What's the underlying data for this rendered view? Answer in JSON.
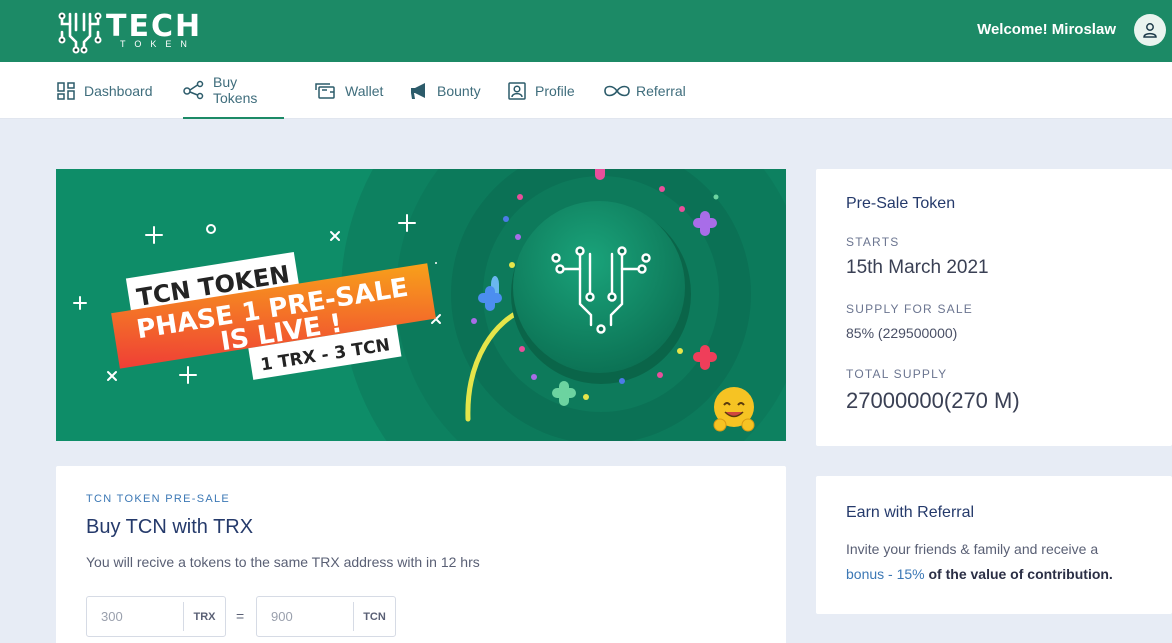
{
  "header": {
    "logo_word": "TECH",
    "logo_sub": "TOKEN",
    "welcome": "Welcome! Miroslaw"
  },
  "nav": {
    "items": [
      {
        "label": "Dashboard",
        "icon": "dashboard-icon"
      },
      {
        "label": "Buy Tokens",
        "icon": "share-nodes-icon",
        "active": true
      },
      {
        "label": "Wallet",
        "icon": "wallet-icon"
      },
      {
        "label": "Bounty",
        "icon": "megaphone-icon"
      },
      {
        "label": "Profile",
        "icon": "profile-card-icon"
      },
      {
        "label": "Referral",
        "icon": "infinity-icon"
      }
    ]
  },
  "banner": {
    "line1": "TCN TOKEN",
    "line2": "PHASE 1 PRE-SALE",
    "line3": "IS LIVE !",
    "rate": "1 TRX - 3 TCN"
  },
  "presale": {
    "title": "Pre-Sale Token",
    "starts_label": "STARTS",
    "starts_value": "15th March 2021",
    "supply_label": "SUPPLY FOR SALE",
    "supply_value": "85% (229500000)",
    "total_label": "TOTAL SUPPLY",
    "total_value": "27000000(270 M)"
  },
  "referral": {
    "title": "Earn with Referral",
    "text_a": "Invite your friends & family and receive a",
    "bonus": "bonus - 15%",
    "text_b": " of the value of contribution."
  },
  "buy": {
    "eyebrow": "TCN TOKEN PRE-SALE",
    "title": "Buy TCN with TRX",
    "description": "You will recive a tokens to the same TRX address with in 12 hrs",
    "trx_placeholder": "300",
    "trx_unit": "TRX",
    "equals": "=",
    "tcn_placeholder": "900",
    "tcn_unit": "TCN"
  },
  "colors": {
    "brand": "#1c8a66",
    "accent_orange": "#f37a1f",
    "link_blue": "#3c78b5",
    "background": "#e7ecf5"
  }
}
